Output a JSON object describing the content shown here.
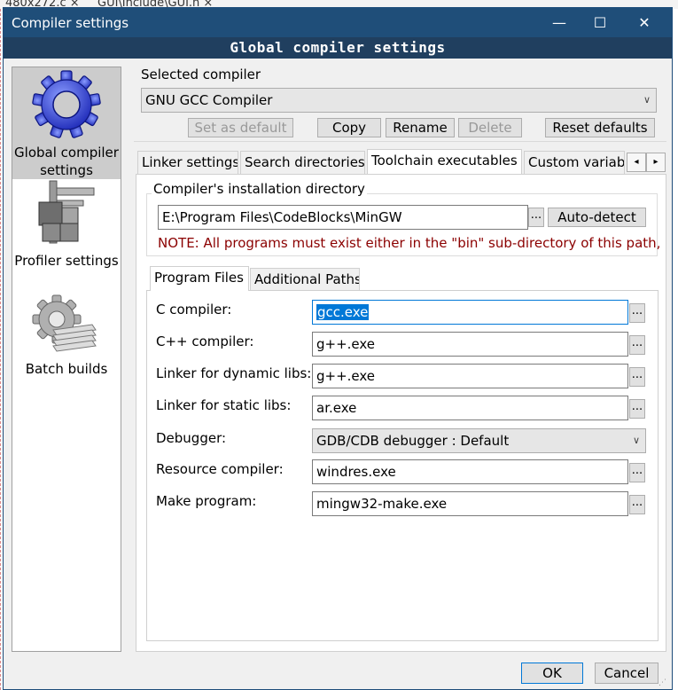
{
  "background": {
    "tabs": [
      {
        "label": "480x272.c ×"
      },
      {
        "label": "GUI\\Include\\GUI.h ×"
      }
    ]
  },
  "window": {
    "title": "Compiler settings",
    "banner": "Global compiler settings",
    "controls": {
      "minimize": "—",
      "maximize": "☐",
      "close": "✕"
    }
  },
  "sidebar": {
    "items": [
      {
        "label": "Global compiler settings",
        "icon": "gear-icon",
        "selected": true
      },
      {
        "label": "Profiler settings",
        "icon": "caliper-icon",
        "selected": false
      },
      {
        "label": "Batch builds",
        "icon": "batch-gear-icon",
        "selected": false
      }
    ]
  },
  "compiler": {
    "section_label": "Selected compiler",
    "selected": "GNU GCC Compiler",
    "buttons": {
      "set_default": "Set as default",
      "copy": "Copy",
      "rename": "Rename",
      "delete": "Delete",
      "reset": "Reset defaults"
    }
  },
  "tabs": [
    {
      "label": "Linker settings"
    },
    {
      "label": "Search directories"
    },
    {
      "label": "Toolchain executables"
    },
    {
      "label": "Custom variabl"
    }
  ],
  "tab_scroll": {
    "left": "◂",
    "right": "▸"
  },
  "install": {
    "group_title": "Compiler's installation directory",
    "path": "E:\\Program Files\\CodeBlocks\\MinGW",
    "browse": "...",
    "auto_detect": "Auto-detect",
    "note": "NOTE: All programs must exist either in the \"bin\" sub-directory of this path,"
  },
  "subtabs": [
    {
      "label": "Program Files"
    },
    {
      "label": "Additional Paths"
    }
  ],
  "programs": {
    "c_compiler": {
      "label": "C compiler:",
      "value": "gcc.exe"
    },
    "cpp_compiler": {
      "label": "C++ compiler:",
      "value": "g++.exe"
    },
    "linker_dynamic": {
      "label": "Linker for dynamic libs:",
      "value": "g++.exe"
    },
    "linker_static": {
      "label": "Linker for static libs:",
      "value": "ar.exe"
    },
    "debugger": {
      "label": "Debugger:",
      "value": "GDB/CDB debugger : Default"
    },
    "resource_compiler": {
      "label": "Resource compiler:",
      "value": "windres.exe"
    },
    "make": {
      "label": "Make program:",
      "value": "mingw32-make.exe"
    },
    "browse": "..."
  },
  "footer": {
    "ok": "OK",
    "cancel": "Cancel"
  },
  "colors": {
    "titlebar": "#1f4e79",
    "banner": "#203f5f",
    "note": "#8b0000",
    "selection": "#0078d7"
  }
}
